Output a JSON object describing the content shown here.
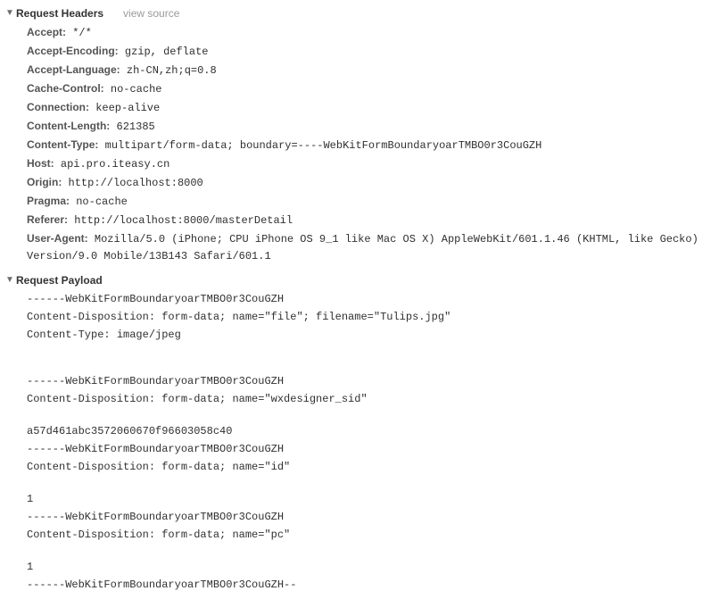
{
  "sections": {
    "request_headers": {
      "title": "Request Headers",
      "view_source": "view source",
      "headers": [
        {
          "name": "Accept:",
          "value": "*/*"
        },
        {
          "name": "Accept-Encoding:",
          "value": "gzip, deflate"
        },
        {
          "name": "Accept-Language:",
          "value": "zh-CN,zh;q=0.8"
        },
        {
          "name": "Cache-Control:",
          "value": "no-cache"
        },
        {
          "name": "Connection:",
          "value": "keep-alive"
        },
        {
          "name": "Content-Length:",
          "value": "621385"
        },
        {
          "name": "Content-Type:",
          "value": "multipart/form-data; boundary=----WebKitFormBoundaryoarTMBO0r3CouGZH"
        },
        {
          "name": "Host:",
          "value": "api.pro.iteasy.cn"
        },
        {
          "name": "Origin:",
          "value": "http://localhost:8000"
        },
        {
          "name": "Pragma:",
          "value": "no-cache"
        },
        {
          "name": "Referer:",
          "value": "http://localhost:8000/masterDetail"
        },
        {
          "name": "User-Agent:",
          "value": "Mozilla/5.0 (iPhone; CPU iPhone OS 9_1 like Mac OS X) AppleWebKit/601.1.46 (KHTML, like Gecko) Version/9.0 Mobile/13B143 Safari/601.1"
        }
      ]
    },
    "request_payload": {
      "title": "Request Payload",
      "lines": [
        "------WebKitFormBoundaryoarTMBO0r3CouGZH",
        "Content-Disposition: form-data; name=\"file\"; filename=\"Tulips.jpg\"",
        "Content-Type: image/jpeg",
        "",
        "",
        "------WebKitFormBoundaryoarTMBO0r3CouGZH",
        "Content-Disposition: form-data; name=\"wxdesigner_sid\"",
        "",
        "a57d461abc3572060670f96603058c40",
        "------WebKitFormBoundaryoarTMBO0r3CouGZH",
        "Content-Disposition: form-data; name=\"id\"",
        "",
        "1",
        "------WebKitFormBoundaryoarTMBO0r3CouGZH",
        "Content-Disposition: form-data; name=\"pc\"",
        "",
        "1",
        "------WebKitFormBoundaryoarTMBO0r3CouGZH--"
      ]
    }
  }
}
